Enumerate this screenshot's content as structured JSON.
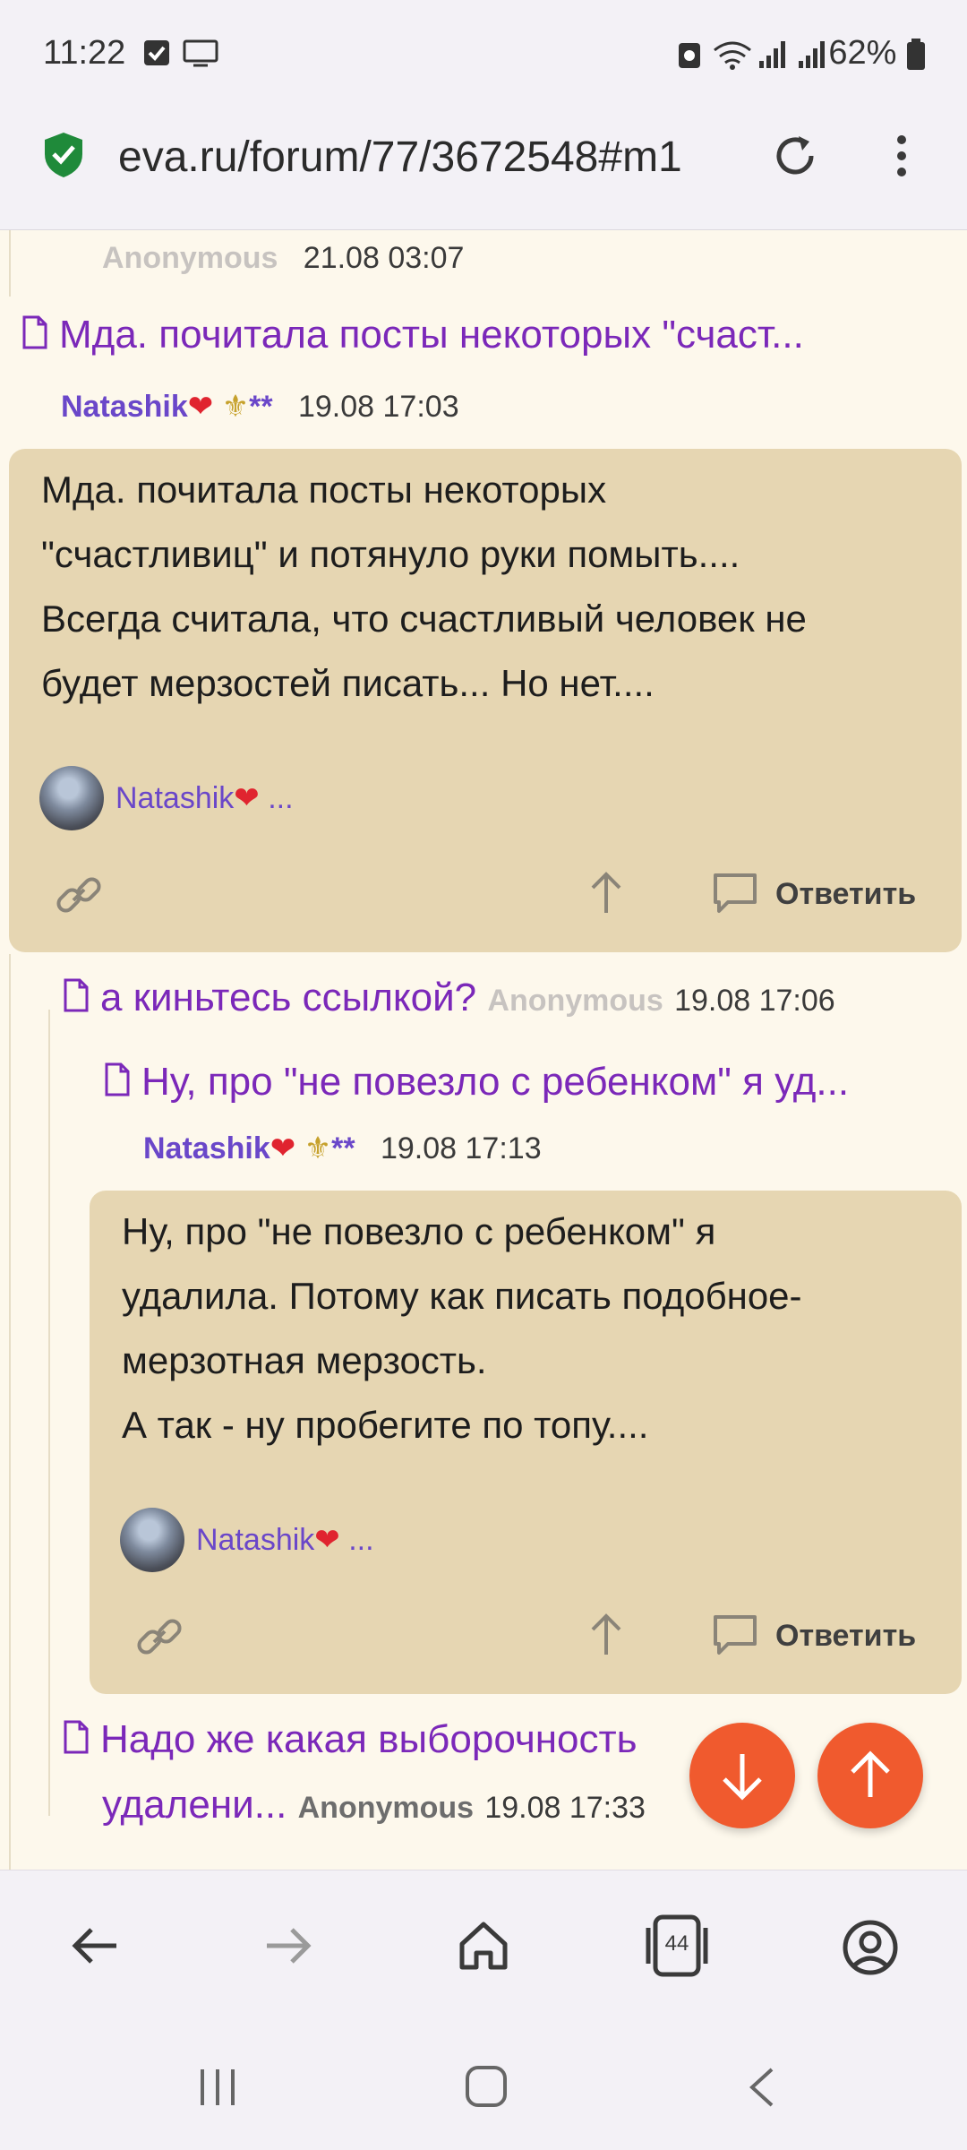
{
  "status_bar": {
    "time": "11:22",
    "battery": "62%",
    "icons": [
      "checkbox-notification-icon",
      "screen-cast-icon",
      "battery-saver-icon",
      "wifi-icon",
      "signal-icon",
      "signal-icon-2",
      "battery-icon"
    ]
  },
  "browser": {
    "url": "eva.ru/forum/77/3672548#m1",
    "secure_icon": "shield-check-icon"
  },
  "thread": {
    "prev_meta": {
      "author": "Anonymous",
      "time": "21.08 03:07"
    },
    "post1": {
      "title": "Мда. почитала посты некоторых \"счаст...",
      "author": "Natashik",
      "badges": "**",
      "time": "19.08 17:03",
      "body": [
        "Мда. почитала посты некоторых",
        "\"счастливиц\" и потянуло руки помыть....",
        "Всегда считала, что счастливый человек не",
        "будет мерзостей писать... Но нет...."
      ],
      "signature": "Natashik",
      "signature_suffix": "...",
      "reply_label": "Ответить"
    },
    "reply1": {
      "title": "а киньтесь ссылкой?",
      "author": "Anonymous",
      "time": "19.08 17:06"
    },
    "post2": {
      "title": "Ну, про \"не повезло с ребенком\" я уд...",
      "author": "Natashik",
      "badges": "**",
      "time": "19.08 17:13",
      "body": [
        "Ну, про \"не повезло с ребенком\" я",
        "удалила. Потому как писать подобное-",
        "мерзотная мерзость.",
        "А так - ну пробегите по топу...."
      ],
      "signature": "Natashik",
      "signature_suffix": "...",
      "reply_label": "Ответить"
    },
    "reply2": {
      "title_line1": "Надо же какая выборочность",
      "title_line2": "удалени...",
      "author": "Anonymous",
      "time": "19.08 17:33"
    }
  },
  "toolbar": {
    "tab_count": "44"
  },
  "colors": {
    "accent": "#7b28b9",
    "author": "#6a47c9",
    "card": "#e6d6b2",
    "fab": "#f05a2e",
    "background": "#fdf8ec"
  }
}
